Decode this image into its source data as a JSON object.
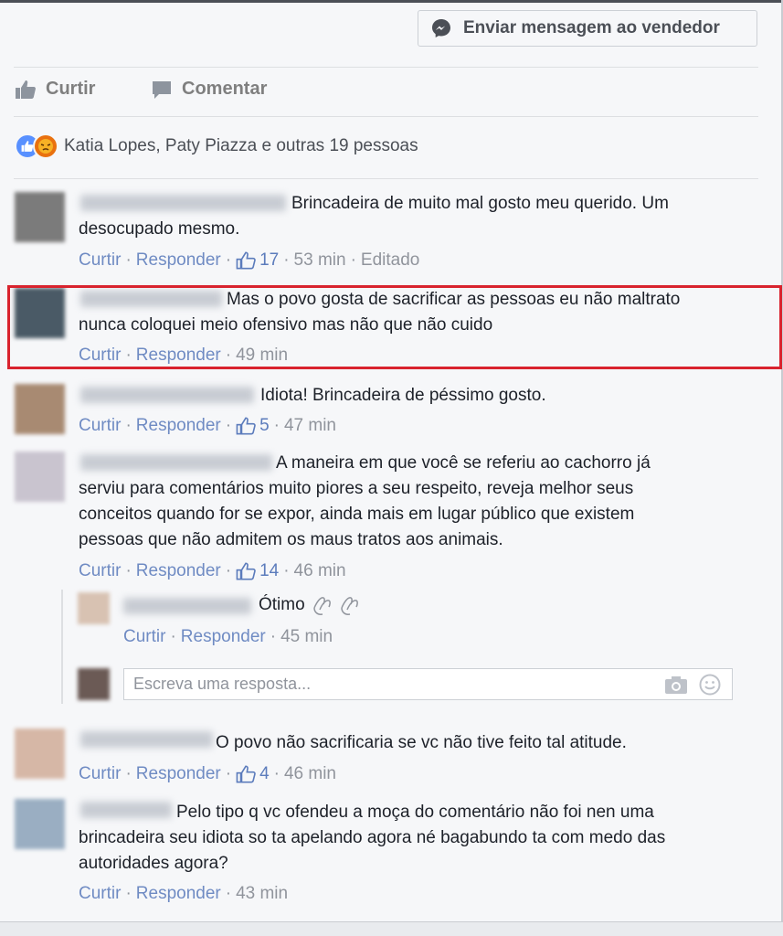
{
  "header": {
    "message_seller_label": "Enviar mensagem ao vendedor",
    "message_icon": "messenger-icon"
  },
  "actions": {
    "like_label": "Curtir",
    "comment_label": "Comentar"
  },
  "reactions": {
    "text": "Katia Lopes, Paty Piazza e outras 19 pessoas",
    "icons": [
      "like-reaction-icon",
      "angry-reaction-icon"
    ]
  },
  "labels": {
    "like": "Curtir",
    "reply": "Responder",
    "sep": "·"
  },
  "comments": [
    {
      "line1": "Brincadeira de muito mal gosto meu querido. Um",
      "line2": "desocupado mesmo.",
      "likes": "17",
      "time": "53 min",
      "edited": "Editado"
    },
    {
      "line1": "Mas o povo gosta de sacrificar as pessoas eu não maltrato",
      "line2": "nunca coloquei meio ofensivo mas não que não cuido",
      "time": "49 min"
    },
    {
      "line1": "Idiota! Brincadeira de péssimo gosto.",
      "likes": "5",
      "time": "47 min"
    },
    {
      "line1": "A maneira em que você se referiu ao cachorro já",
      "line2": "serviu para comentários muito piores a seu respeito, reveja melhor seus",
      "line3": "conceitos quando for se expor, ainda mais em lugar público que existem",
      "line4": "pessoas que não admitem os maus tratos aos animais.",
      "likes": "14",
      "time": "46 min"
    },
    {
      "line1": "O povo não sacrificaria se vc não tive feito tal atitude.",
      "likes": "4",
      "time": "46 min"
    },
    {
      "line1": "Pelo tipo q vc ofendeu a moça do comentário não foi nen uma",
      "line2": "brincadeira seu idiota so ta apelando agora né bagabundo ta com medo das",
      "line3": "autoridades agora?",
      "time": "43 min"
    }
  ],
  "reply": {
    "text": "Ótimo",
    "emoji": "clapping-hands-icon",
    "time": "45 min"
  },
  "reply_box": {
    "placeholder": "Escreva uma resposta...",
    "icons": [
      "camera-icon",
      "smiley-icon"
    ]
  },
  "colors": {
    "background": "#f6f7f9",
    "link": "#4267b2",
    "meta": "#90949c",
    "highlight": "#d9232e"
  }
}
